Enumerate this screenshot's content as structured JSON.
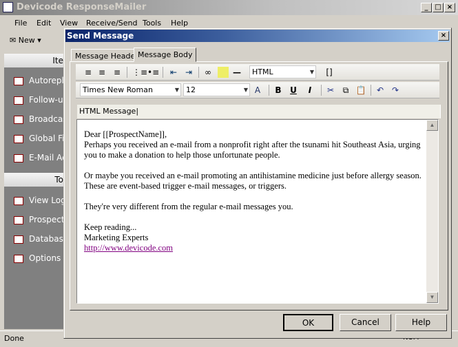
{
  "app": {
    "title": "Devicode ResponseMailer",
    "menu": [
      "File",
      "Edit",
      "View",
      "Receive/Send",
      "Tools",
      "Help"
    ],
    "toolbar_new": "New",
    "status": "Done",
    "num": "NUM"
  },
  "sidebar": {
    "header1": "Ite",
    "items1": [
      "Autoreply",
      "Follow-up",
      "Broadcast",
      "Global Fiel",
      "E-Mail Acc"
    ],
    "header2": "To",
    "items2": [
      "View Logs",
      "Prospect M",
      "Database",
      "Options"
    ]
  },
  "dialog": {
    "title": "Send Message",
    "tabs": [
      "Message Header",
      "Message Body"
    ],
    "active_tab": "Message Body",
    "format_select": "HTML",
    "font_select": "Times New Roman",
    "size_select": "12",
    "field_label": "HTML Message",
    "body": {
      "greeting": "Dear [[ProspectName]],",
      "p1": "Perhaps you received an e-mail from a nonprofit right after the tsunami hit Southeast Asia, urging you to make a donation to help those unfortunate people.",
      "p2": "Or maybe you received an e-mail promoting an antihistamine medicine just before allergy season. These are event-based trigger e-mail messages, or triggers.",
      "p3": "They're very different from the regular e-mail messages you.",
      "closing1": "Keep reading...",
      "closing2": "Marketing Experts",
      "link": "http://www.devicode.com"
    },
    "buttons": {
      "ok": "OK",
      "cancel": "Cancel",
      "help": "Help"
    }
  }
}
